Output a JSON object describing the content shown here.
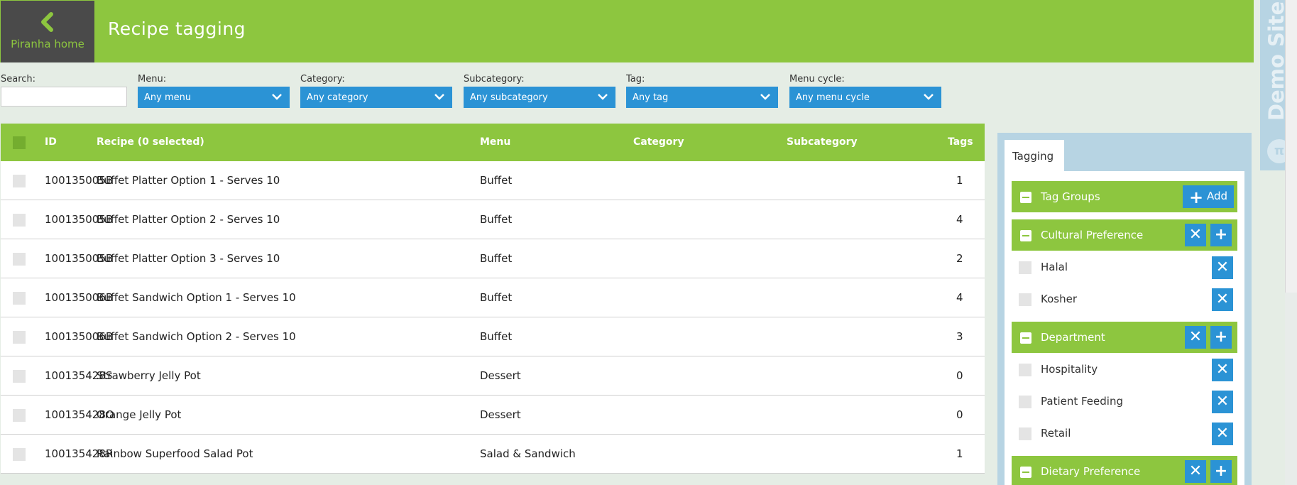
{
  "header": {
    "home_label": "Piranha home",
    "title": "Recipe tagging"
  },
  "demo": {
    "text": "Demo Site"
  },
  "filters": {
    "search": {
      "label": "Search:",
      "value": "",
      "placeholder": ""
    },
    "menu": {
      "label": "Menu:",
      "selected": "Any menu"
    },
    "category": {
      "label": "Category:",
      "selected": "Any category"
    },
    "subcategory": {
      "label": "Subcategory:",
      "selected": "Any subcategory"
    },
    "tag": {
      "label": "Tag:",
      "selected": "Any tag"
    },
    "menu_cycle": {
      "label": "Menu cycle:",
      "selected": "Any menu cycle"
    }
  },
  "table": {
    "columns": {
      "id": "ID",
      "recipe": "Recipe (0 selected)",
      "menu": "Menu",
      "category": "Category",
      "subcategory": "Subcategory",
      "tags": "Tags"
    },
    "rows": [
      {
        "id": "100135005B",
        "name": "Buffet Platter Option 1 - Serves 10",
        "menu": "Buffet",
        "category": "",
        "subcategory": "",
        "tags": "1"
      },
      {
        "id": "100135005B",
        "name": "Buffet Platter Option 2 - Serves 10",
        "menu": "Buffet",
        "category": "",
        "subcategory": "",
        "tags": "4"
      },
      {
        "id": "100135005B",
        "name": "Buffet Platter Option 3 - Serves 10",
        "menu": "Buffet",
        "category": "",
        "subcategory": "",
        "tags": "2"
      },
      {
        "id": "100135006B",
        "name": "Buffet Sandwich Option 1 - Serves 10",
        "menu": "Buffet",
        "category": "",
        "subcategory": "",
        "tags": "4"
      },
      {
        "id": "100135006B",
        "name": "Buffet Sandwich Option 2 - Serves 10",
        "menu": "Buffet",
        "category": "",
        "subcategory": "",
        "tags": "3"
      },
      {
        "id": "100135428S",
        "name": "Strawberry Jelly Pot",
        "menu": "Dessert",
        "category": "",
        "subcategory": "",
        "tags": "0"
      },
      {
        "id": "100135428O",
        "name": "Orange Jelly Pot",
        "menu": "Dessert",
        "category": "",
        "subcategory": "",
        "tags": "0"
      },
      {
        "id": "100135428R",
        "name": "Rainbow Superfood Salad Pot",
        "menu": "Salad & Sandwich",
        "category": "",
        "subcategory": "",
        "tags": "1"
      }
    ]
  },
  "tagging": {
    "tab_label": "Tagging",
    "tag_groups_label": "Tag Groups",
    "add_label": "Add",
    "groups": [
      {
        "name": "Cultural Preference",
        "tags": [
          "Halal",
          "Kosher"
        ]
      },
      {
        "name": "Department",
        "tags": [
          "Hospitality",
          "Patient Feeding",
          "Retail"
        ]
      },
      {
        "name": "Dietary Preference",
        "tags": []
      }
    ]
  },
  "colors": {
    "brand_green": "#8dc63f",
    "button_blue": "#2b93d5",
    "header_dark": "#4a4a4a",
    "panel_blue": "#b7d4e3"
  }
}
